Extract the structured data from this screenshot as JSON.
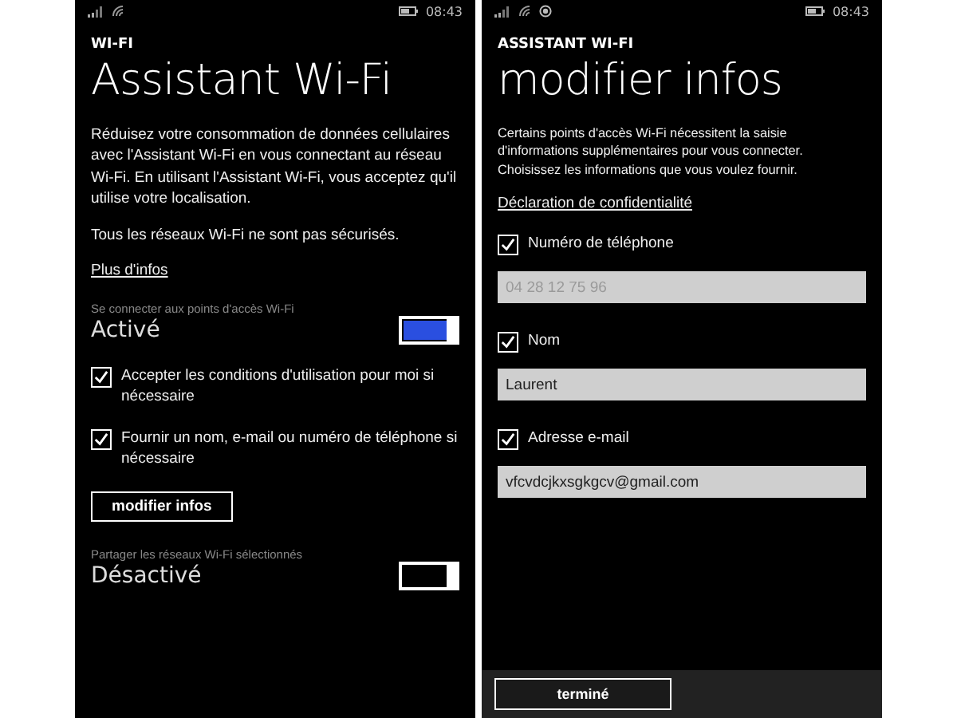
{
  "screens": [
    {
      "status_bar": {
        "time": "08:43",
        "icons": [
          {
            "kind": "signal"
          },
          {
            "kind": "wifi"
          }
        ]
      },
      "header": "WI-FI",
      "title": "Assistant Wi-Fi",
      "items": [
        {
          "kind": "paragraph",
          "text": "Réduisez votre consommation de données cellulaires avec l'Assistant Wi-Fi en vous connectant au réseau Wi-Fi. En utilisant l'Assistant Wi-Fi, vous acceptez qu'il utilise votre localisation."
        },
        {
          "kind": "paragraph",
          "text": "Tous les réseaux Wi-Fi ne sont pas sécurisés."
        },
        {
          "kind": "link",
          "text": "Plus d'infos"
        },
        {
          "kind": "toggle",
          "label": "Se connecter aux points d'accès Wi-Fi",
          "state": "Activé",
          "on": true
        },
        {
          "kind": "checkbox",
          "label": "Accepter les conditions d'utilisation pour moi si nécessaire",
          "checked": true
        },
        {
          "kind": "checkbox",
          "label": "Fournir un nom, e-mail ou numéro de téléphone si nécessaire",
          "checked": true
        },
        {
          "kind": "button",
          "label": "modifier infos"
        },
        {
          "kind": "toggle",
          "label": "Partager les réseaux Wi-Fi sélectionnés",
          "state": "Désactivé",
          "on": false
        }
      ]
    },
    {
      "status_bar": {
        "time": "08:43",
        "icons": [
          {
            "kind": "signal"
          },
          {
            "kind": "wifi"
          },
          {
            "kind": "location"
          }
        ]
      },
      "header": "ASSISTANT WI-FI",
      "title": "modifier infos",
      "items": [
        {
          "kind": "small_paragraph",
          "text": "Certains points d'accès Wi-Fi nécessitent la saisie d'informations supplémentaires pour vous connecter. Choisissez les informations que vous voulez fournir."
        },
        {
          "kind": "link",
          "text": "Déclaration de confidentialité"
        },
        {
          "kind": "checkbox",
          "label": "Numéro de téléphone",
          "checked": true
        },
        {
          "kind": "field",
          "value": "04 28 12 75 96",
          "disabled": true
        },
        {
          "kind": "checkbox",
          "label": "Nom",
          "checked": true
        },
        {
          "kind": "field",
          "value": "Laurent",
          "disabled": false
        },
        {
          "kind": "checkbox",
          "label": "Adresse e-mail",
          "checked": true
        },
        {
          "kind": "field",
          "value": "vfcvdcjkxsgkgcv@gmail.com",
          "disabled": false
        }
      ],
      "app_bar": {
        "button": "terminé"
      }
    }
  ]
}
